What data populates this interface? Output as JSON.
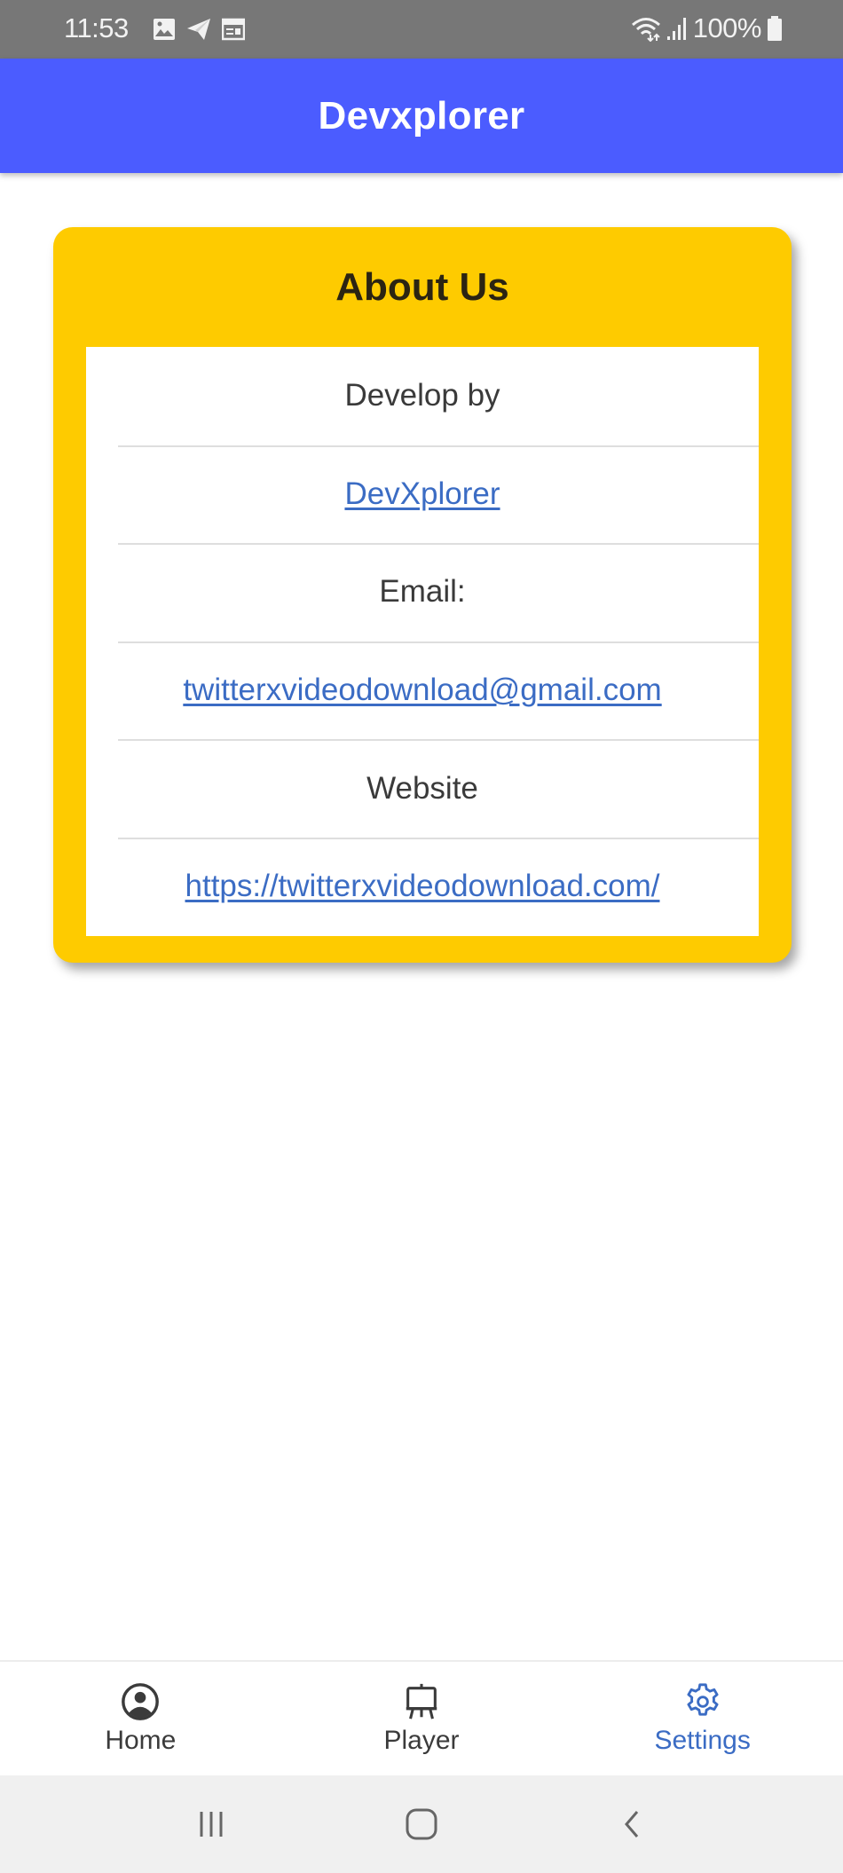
{
  "status_bar": {
    "time": "11:53",
    "left_icons": [
      "gallery-icon",
      "telegram-icon",
      "calendar-icon"
    ],
    "right_icons": [
      "wifi-icon",
      "signal-icon"
    ],
    "battery_percent": "100%"
  },
  "app_bar": {
    "title": "Devxplorer",
    "color": "#4b5cff"
  },
  "about_card": {
    "title": "About Us",
    "color": "#fecb00",
    "rows": [
      {
        "text": "Develop by",
        "type": "label"
      },
      {
        "text": "DevXplorer",
        "type": "link"
      },
      {
        "text": "Email:",
        "type": "label"
      },
      {
        "text": "twitterxvideodownload@gmail.com",
        "type": "link"
      },
      {
        "text": "Website",
        "type": "label"
      },
      {
        "text": "https://twitterxvideodownload.com/",
        "type": "link"
      }
    ],
    "link_color": "#3b6cc4"
  },
  "bottom_nav": {
    "items": [
      {
        "label": "Home",
        "icon": "account-circle-icon",
        "active": false
      },
      {
        "label": "Player",
        "icon": "easel-icon",
        "active": false
      },
      {
        "label": "Settings",
        "icon": "gear-icon",
        "active": true
      }
    ],
    "active_color": "#3b6cc4"
  },
  "system_nav": {
    "buttons": [
      "recent-apps",
      "home",
      "back"
    ]
  }
}
